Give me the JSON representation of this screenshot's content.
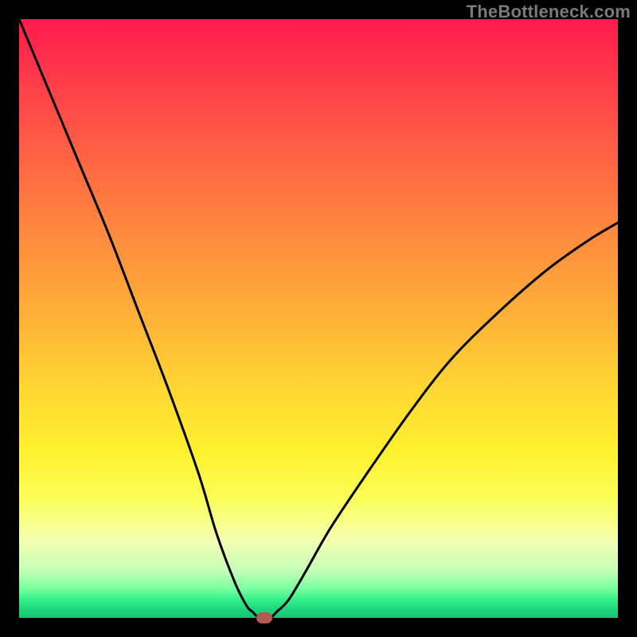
{
  "watermark": "TheBottleneck.com",
  "colors": {
    "frame": "#000000",
    "curve": "#000000",
    "marker": "#b35a52",
    "gradient_top": "#ff1a4d",
    "gradient_bottom": "#17c270"
  },
  "chart_data": {
    "type": "line",
    "title": "",
    "xlabel": "",
    "ylabel": "",
    "xlim": [
      0,
      100
    ],
    "ylim": [
      0,
      100
    ],
    "grid": false,
    "legend": false,
    "series": [
      {
        "name": "bottleneck-curve",
        "x": [
          0,
          5,
          10,
          15,
          20,
          25,
          30,
          33,
          36,
          38,
          39,
          40,
          41,
          42,
          43,
          45,
          48,
          52,
          58,
          65,
          72,
          80,
          88,
          95,
          100
        ],
        "y": [
          100,
          88,
          76,
          64,
          51,
          38,
          24,
          14,
          6,
          2,
          1,
          0,
          0,
          0,
          1,
          3,
          8,
          15,
          24,
          34,
          43,
          51,
          58,
          63,
          66
        ]
      }
    ],
    "marker": {
      "x": 41,
      "y": 0
    },
    "axes_visible": false
  }
}
